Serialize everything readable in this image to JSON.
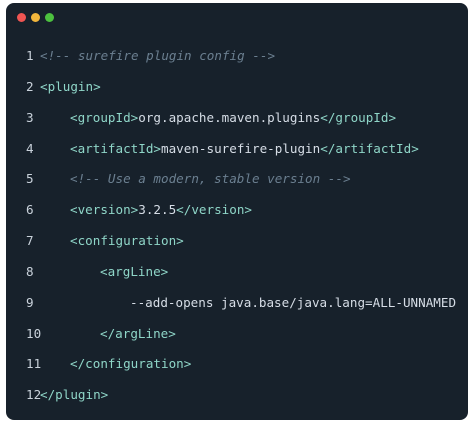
{
  "window": {
    "controls": {
      "close_color": "#ef5552",
      "minimize_color": "#f2b63c",
      "maximize_color": "#4cc13f"
    }
  },
  "theme": {
    "background": "#17212b",
    "line_number_color": "#c9d2db",
    "tag_color": "#8fd6c8",
    "text_color": "#d6dde6",
    "comment_color": "#6b7f90"
  },
  "code": {
    "language": "xml",
    "lines": [
      {
        "number": "1",
        "indent": 0,
        "segments": [
          {
            "kind": "cmt",
            "text": "<!-- surefire plugin config -->"
          }
        ]
      },
      {
        "number": "2",
        "indent": 0,
        "segments": [
          {
            "kind": "tag",
            "text": "<plugin>"
          }
        ]
      },
      {
        "number": "3",
        "indent": 1,
        "segments": [
          {
            "kind": "tag",
            "text": "<groupId>"
          },
          {
            "kind": "txt",
            "text": "org.apache.maven.plugins"
          },
          {
            "kind": "tag",
            "text": "</groupId>"
          }
        ]
      },
      {
        "number": "4",
        "indent": 1,
        "segments": [
          {
            "kind": "tag",
            "text": "<artifactId>"
          },
          {
            "kind": "txt",
            "text": "maven-surefire-plugin"
          },
          {
            "kind": "tag",
            "text": "</artifactId>"
          }
        ]
      },
      {
        "number": "5",
        "indent": 1,
        "segments": [
          {
            "kind": "cmt",
            "text": "<!-- Use a modern, stable version -->"
          }
        ]
      },
      {
        "number": "6",
        "indent": 1,
        "segments": [
          {
            "kind": "tag",
            "text": "<version>"
          },
          {
            "kind": "txt",
            "text": "3.2.5"
          },
          {
            "kind": "tag",
            "text": "</version>"
          }
        ]
      },
      {
        "number": "7",
        "indent": 1,
        "segments": [
          {
            "kind": "tag",
            "text": "<configuration>"
          }
        ]
      },
      {
        "number": "8",
        "indent": 2,
        "segments": [
          {
            "kind": "tag",
            "text": "<argLine>"
          }
        ]
      },
      {
        "number": "9",
        "indent": 3,
        "segments": [
          {
            "kind": "txt",
            "text": "--add-opens java.base/java.lang=ALL-UNNAMED"
          }
        ]
      },
      {
        "number": "10",
        "indent": 2,
        "segments": [
          {
            "kind": "tag",
            "text": "</argLine>"
          }
        ]
      },
      {
        "number": "11",
        "indent": 1,
        "segments": [
          {
            "kind": "tag",
            "text": "</configuration>"
          }
        ]
      },
      {
        "number": "12",
        "indent": 0,
        "segments": [
          {
            "kind": "tag",
            "text": "</plugin>"
          }
        ]
      }
    ]
  }
}
